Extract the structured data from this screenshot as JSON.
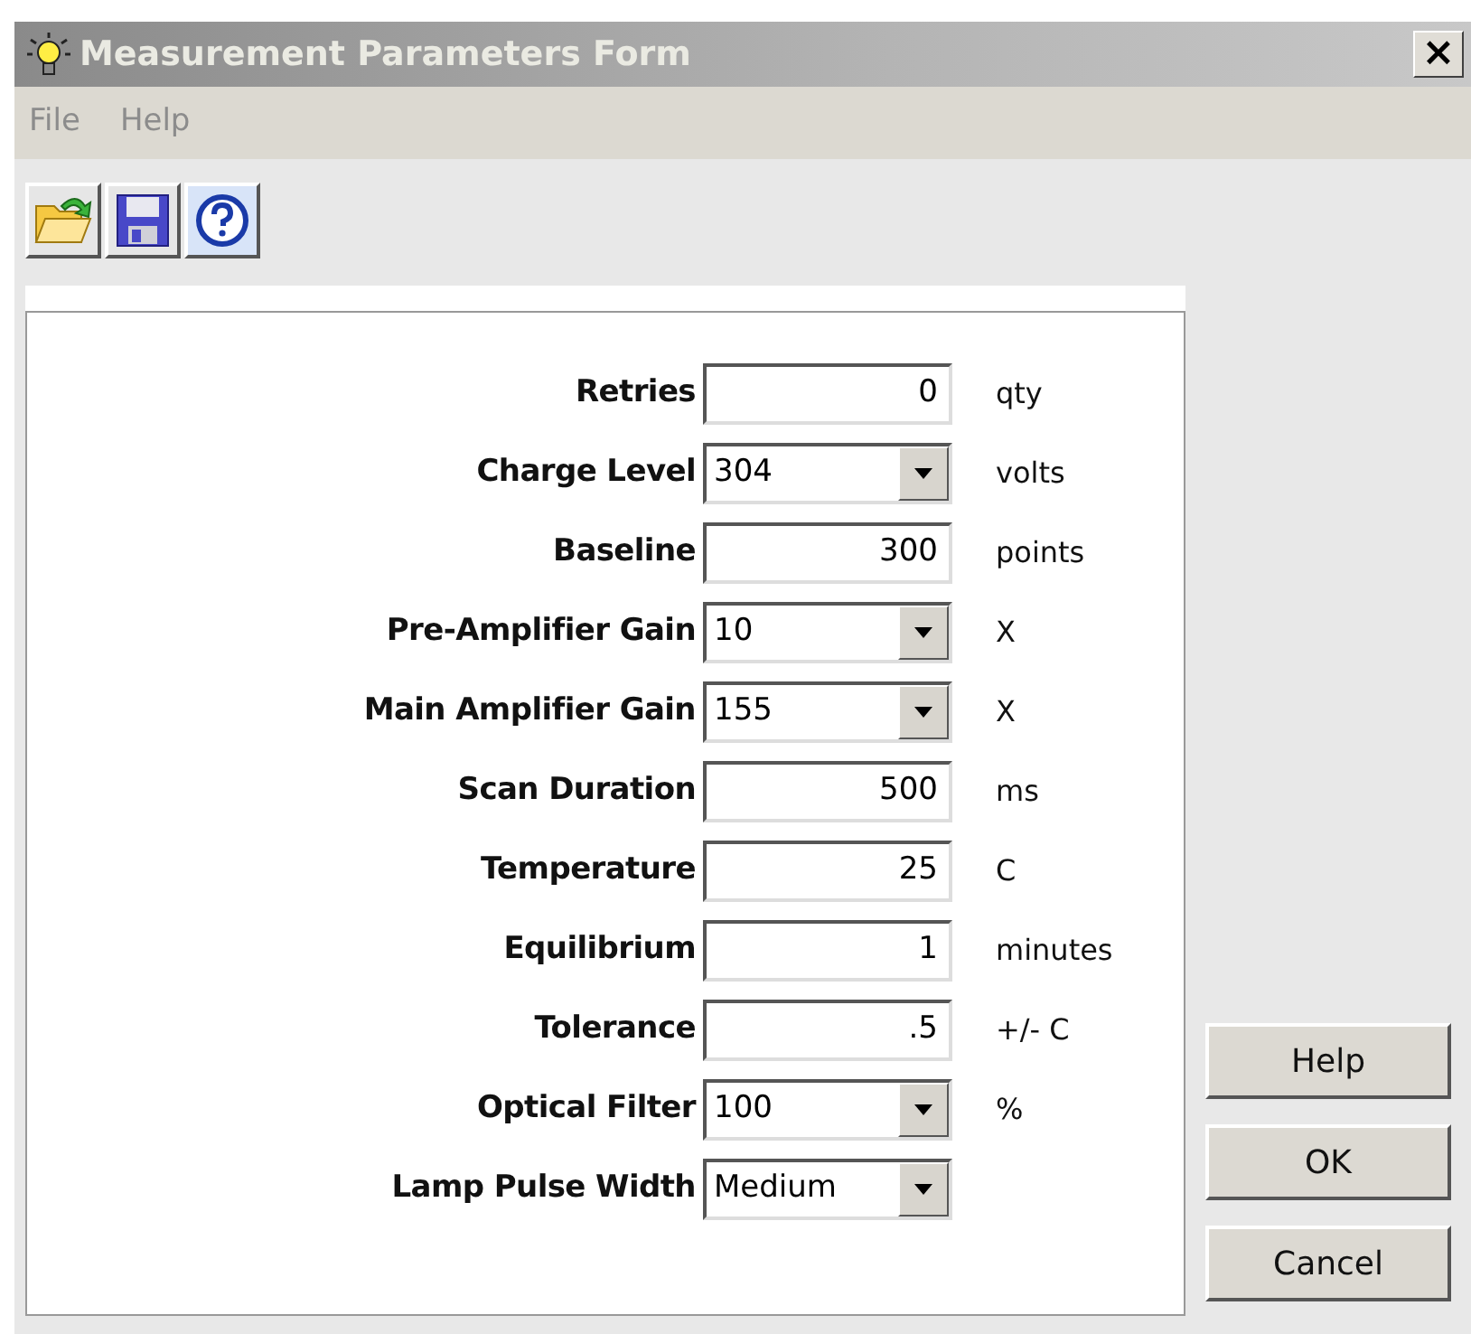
{
  "window": {
    "title": "Measurement Parameters Form",
    "close": "×"
  },
  "menu": [
    "File",
    "Help"
  ],
  "fields": [
    {
      "label": "Retries",
      "kind": "text",
      "value": "0",
      "unit": "qty"
    },
    {
      "label": "Charge Level",
      "kind": "combo",
      "value": "304",
      "unit": "volts"
    },
    {
      "label": "Baseline",
      "kind": "text",
      "value": "300",
      "unit": "points"
    },
    {
      "label": "Pre-Amplifier Gain",
      "kind": "combo",
      "value": "10",
      "unit": "X"
    },
    {
      "label": "Main Amplifier Gain",
      "kind": "combo",
      "value": "155",
      "unit": "X"
    },
    {
      "label": "Scan Duration",
      "kind": "text",
      "value": "500",
      "unit": "ms"
    },
    {
      "label": "Temperature",
      "kind": "text",
      "value": "25",
      "unit": "C"
    },
    {
      "label": "Equilibrium",
      "kind": "text",
      "value": "1",
      "unit": "minutes"
    },
    {
      "label": "Tolerance",
      "kind": "text",
      "value": ".5",
      "unit": "+/- C"
    },
    {
      "label": "Optical Filter",
      "kind": "combo",
      "value": "100",
      "unit": "%"
    },
    {
      "label": "Lamp Pulse Width",
      "kind": "combo",
      "value": "Medium"
    }
  ],
  "buttons": [
    "Help",
    "OK",
    "Cancel"
  ]
}
